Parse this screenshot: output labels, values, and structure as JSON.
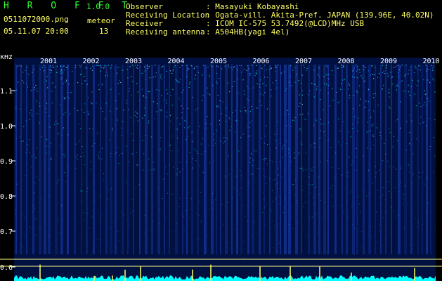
{
  "header": {
    "app_name": "H R O F F T",
    "version": "1.0.0",
    "filename": "0511072000.png",
    "datetime": "05.11.07 20:00",
    "meteor_label": "meteor",
    "meteor_count": "13",
    "fields": [
      {
        "label": "Observer",
        "value": ": Masayuki Kobayashi"
      },
      {
        "label": "Receiving Location",
        "value": ": Ogata-vill. Akita-Pref. JAPAN (139.96E, 40.02N)"
      },
      {
        "label": "Receiver",
        "value": ": ICOM IC-575 53.7492(@LCD)MHz USB"
      },
      {
        "label": "Receiving antenna",
        "value": ": A504HB(yagi 4el)"
      }
    ]
  },
  "colors": {
    "title": "#33ff33",
    "labels": "#ffff66",
    "axis": "#ffffff",
    "spectrum_background": "#001040",
    "signal": "#00ffff"
  },
  "spectrogram": {
    "y_unit": "kHz",
    "y_ticks": [
      "1.1",
      "1.0",
      "0.9",
      "0.8",
      "0.7",
      "0.6"
    ],
    "x_ticks": [
      "2001",
      "2002",
      "2003",
      "2004",
      "2005",
      "2006",
      "2007",
      "2008",
      "2009",
      "2010"
    ]
  }
}
